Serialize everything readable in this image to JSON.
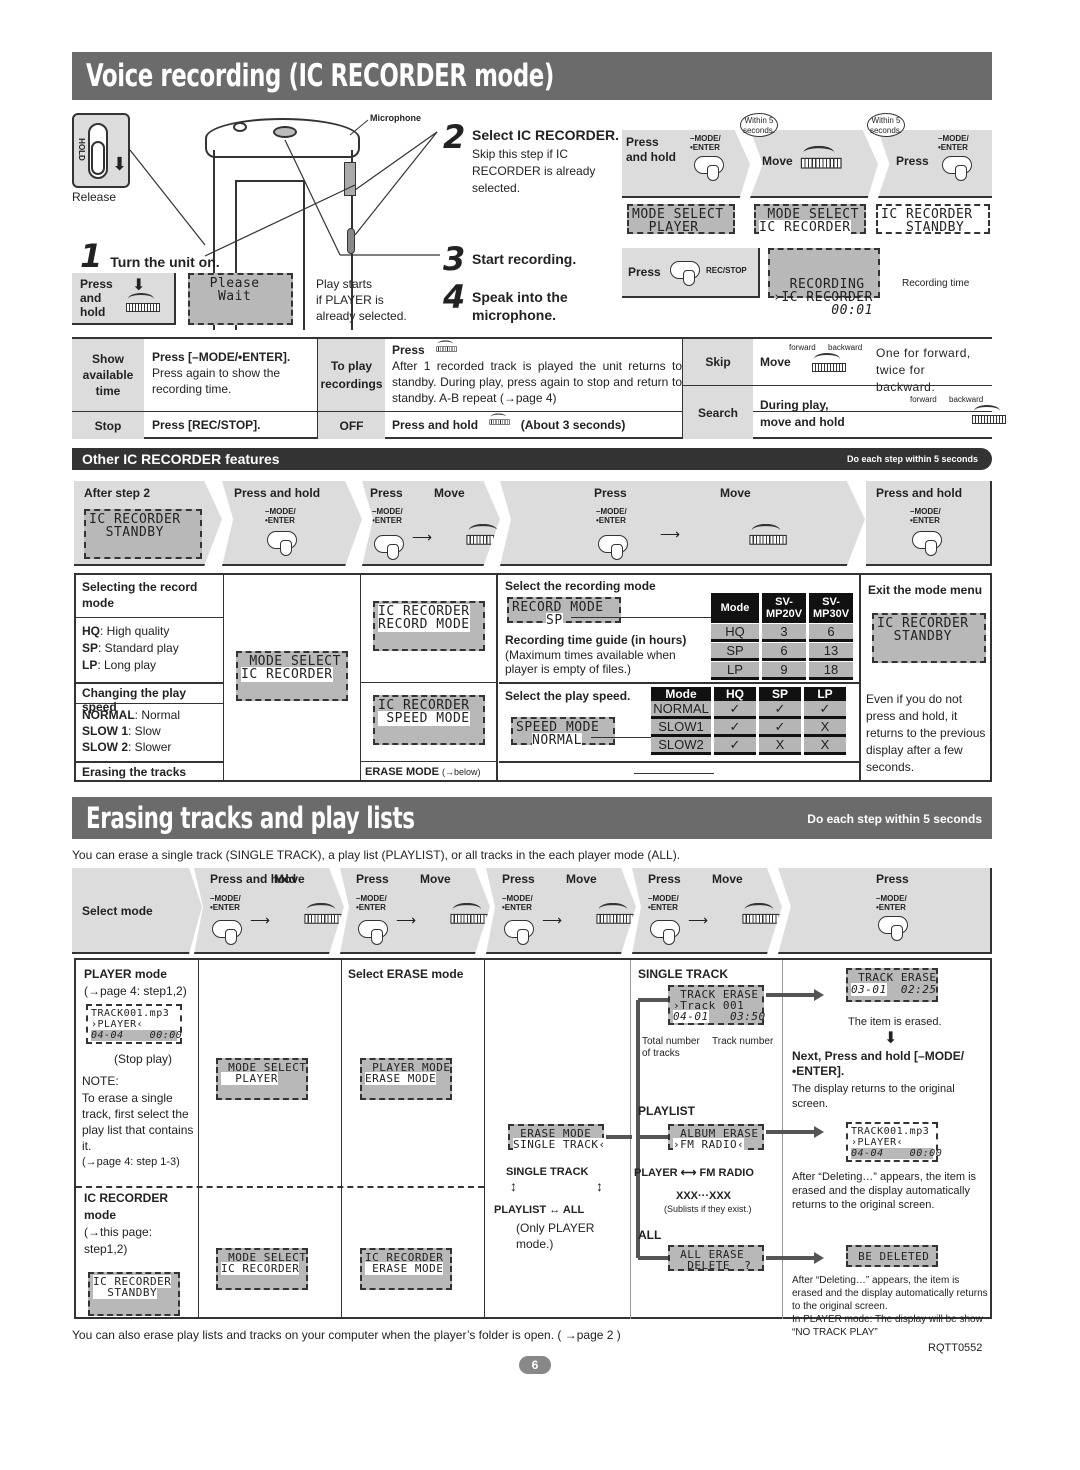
{
  "section1": {
    "title": "Voice recording (IC RECORDER mode)",
    "release_label": "Release",
    "hold_label": "HOLD",
    "microphone_label": "Microphone",
    "step1": {
      "num": "1",
      "title": "Turn the unit on."
    },
    "step1_action": {
      "line1": "Press",
      "line2": "and",
      "line3": "hold"
    },
    "step1_lcd": "  Please\n   Wait",
    "step1_note": [
      "Play starts",
      "if PLAYER is",
      "already selected."
    ],
    "step2": {
      "num": "2",
      "title": "Select IC RECORDER.",
      "desc": [
        "Skip this step if IC",
        "RECORDER is already",
        "selected."
      ]
    },
    "step3": {
      "num": "3",
      "title": "Start recording."
    },
    "step4": {
      "num": "4",
      "title": "Speak into the",
      "title2": "microphone."
    },
    "flow": {
      "press_hold": "Press\nand hold",
      "mode_enter_1": "–MODE/",
      "mode_enter_2": "•ENTER",
      "within1": "Within 5 seconds.",
      "move": "Move",
      "within2": "Within 5 seconds.",
      "press": "Press",
      "lcd1": "MODE SELECT\n  PLAYER",
      "lcd2_l1": " MODE SELECT",
      "lcd2_l2": "IC RECORDER",
      "lcd3_l1": "IC RECORDER",
      "lcd3_l2": "   STANDBY",
      "rec_press": "Press",
      "rec_stop": "REC/STOP",
      "lcd4_l1": "  RECORDING",
      "lcd4_l2": "›IC RECORDER",
      "lcd4_l3": "       00:01",
      "recording_time": "Recording time"
    }
  },
  "ops_table": {
    "rows": [
      {
        "label": "Show available time",
        "bold": "Press [–MODE/•ENTER].",
        "text": "Press again to show the recording time."
      },
      {
        "label": "Stop",
        "bold": "Press [REC/STOP].",
        "text": ""
      }
    ],
    "play": {
      "label": "To play recordings",
      "bold": "Press",
      "text": "After 1 recorded track is played the unit returns to standby. During play, press again to stop and return to standby. A-B repeat (→page 4)"
    },
    "off": {
      "label": "OFF",
      "text": "Press and hold",
      "suffix": "(About 3 seconds)"
    },
    "skip": {
      "label": "Skip",
      "action": "Move",
      "forward": "forward",
      "backward": "backward",
      "text": "One for forward, twice for backward."
    },
    "search": {
      "label": "Search",
      "action": "During play, move and hold",
      "forward": "forward",
      "backward": "backward"
    }
  },
  "features": {
    "title": "Other IC RECORDER features",
    "tip": "Do each step within 5 seconds",
    "flow": {
      "after_step": "After step 2",
      "lcd_standby_l1": "IC RECORDER",
      "lcd_standby_l2": "  STANDBY",
      "press_hold": "Press and hold",
      "press": "Press",
      "move": "Move",
      "press2": "Press",
      "move2": "Move",
      "press_hold2": "Press and hold",
      "mode1": "–MODE/",
      "mode2": "•ENTER"
    },
    "left": {
      "record_title": "Selecting the record mode",
      "record_items": [
        {
          "k": "HQ",
          "v": ": High quality"
        },
        {
          "k": "SP",
          "v": ": Standard play"
        },
        {
          "k": "LP",
          "v": ": Long play"
        }
      ],
      "speed_title": "Changing the play speed",
      "speed_items": [
        {
          "k": "NORMAL",
          "v": ": Normal"
        },
        {
          "k": "SLOW 1",
          "v": ":  Slow"
        },
        {
          "k": "SLOW 2",
          "v": ":  Slower"
        }
      ],
      "erase_title": "Erasing the tracks"
    },
    "lcd_modeselect_l1": " MODE SELECT",
    "lcd_modeselect_l2": "IC RECORDER",
    "lcd_recmode_l1": "IC RECORDER",
    "lcd_recmode_l2": "RECORD MODE",
    "lcd_speedmode_l1": "IC RECORDER",
    "lcd_speedmode_l2": " SPEED MODE",
    "erase_mode": "ERASE MODE",
    "erase_mode_ref": "(→below)",
    "rec_select": {
      "title": "Select the recording mode",
      "lcd_l1": "RECORD MODE",
      "lcd_l2": "SP",
      "guide_title": "Recording time guide (in hours)",
      "guide_text": "(Maximum times available when player is empty of files.)",
      "headers": [
        "Mode",
        "SV-\nMP20V",
        "SV-\nMP30V"
      ],
      "rows": [
        [
          "HQ",
          "3",
          "6"
        ],
        [
          "SP",
          "6",
          "13"
        ],
        [
          "LP",
          "9",
          "18"
        ]
      ]
    },
    "speed_select": {
      "title": "Select the play speed.",
      "lcd_l1": "SPEED MODE",
      "lcd_l2": "NORMAL",
      "headers": [
        "Mode",
        "HQ",
        "SP",
        "LP"
      ],
      "rows": [
        [
          "NORMAL",
          "✓",
          "✓",
          "✓"
        ],
        [
          "SLOW1",
          "✓",
          "✓",
          "X"
        ],
        [
          "SLOW2",
          "✓",
          "X",
          "X"
        ]
      ]
    },
    "exit": {
      "title": "Exit the mode menu",
      "lcd_l1": "IC RECORDER",
      "lcd_l2": "  STANDBY",
      "text": "Even if you do not press and hold, it returns to the previous display after a few seconds."
    }
  },
  "section2": {
    "title": "Erasing tracks and play lists",
    "tip": "Do each step within 5 seconds",
    "intro": "You can erase a single track (SINGLE TRACK), a play list (PLAYLIST), or all tracks in the each player mode (ALL).",
    "flow": {
      "select_mode": "Select mode",
      "steps": [
        {
          "a": "Press and hold",
          "b": "Move"
        },
        {
          "a": "Press",
          "b": "Move"
        },
        {
          "a": "Press",
          "b": "Move"
        },
        {
          "a": "Press",
          "b": "Move"
        },
        {
          "a": "Press",
          "b": ""
        }
      ],
      "mode1": "–MODE/",
      "mode2": "•ENTER"
    },
    "player_mode": {
      "title": "PLAYER mode",
      "ref": "(→page 4: step1,2)",
      "lcd_l1": "TRACK001.mp3",
      "lcd_l2": "›PLAYER‹",
      "lcd_l3": "04-04    00:00",
      "stop_play": "(Stop play)",
      "note_title": "NOTE:",
      "note": "To erase a single track, first select the play list that contains it.",
      "note_ref": "(→page 4: step 1-3)"
    },
    "ic_mode": {
      "title": "IC RECORDER mode",
      "ref": "(→this page: step1,2)",
      "lcd_l1": "IC RECORDER",
      "lcd_l2": "  STANDBY"
    },
    "col2": {
      "lcd_p_l1": " MODE SELECT",
      "lcd_p_l2": "  PLAYER",
      "lcd_i_l1": " MODE SELECT",
      "lcd_i_l2": "IC RECORDER"
    },
    "col3": {
      "title": "Select ERASE mode",
      "lcd_p_l1": " PLAYER MODE",
      "lcd_p_l2": "ERASE MODE",
      "lcd_i_l1": "IC RECORDER",
      "lcd_i_l2": " ERASE MODE"
    },
    "col4": {
      "lcd_l1": " ERASE MODE",
      "lcd_l2": "SINGLE TRACK‹",
      "single": "SINGLE TRACK",
      "playlist": "PLAYLIST",
      "all": "ALL",
      "only": "(Only PLAYER mode.)"
    },
    "col5": {
      "single_title": "SINGLE TRACK",
      "single_lcd_l1": " TRACK ERASE",
      "single_lcd_l2": "›Track 001",
      "single_lcd_l3a": "04-01",
      "single_lcd_l3b": "03:50",
      "total_label": "Total number of tracks",
      "track_label": "Track number",
      "playlist_title": "PLAYLIST",
      "playlist_lcd_l1": " ALBUM ERASE",
      "playlist_lcd_l2": "›FM RADIO‹",
      "player": "PLAYER",
      "fm_radio": "FM RADIO",
      "xxx": "XXX···XXX",
      "sublists": "(Sublists if they exist.)",
      "all_title": "ALL",
      "all_lcd_l1": " ALL ERASE",
      "all_lcd_l2": "  DELETE  ?"
    },
    "col6": {
      "press": "Press",
      "erased_lcd_l1": " TRACK ERASE",
      "erased_lcd_l2a": "03-01",
      "erased_lcd_l2b": "02:25",
      "erased": "The item is erased.",
      "next": "Next, Press and hold [–MODE/•ENTER].",
      "next_desc": "The display returns to the original screen.",
      "pl_lcd_l1": "TRACK001.mp3",
      "pl_lcd_l2": "›PLAYER‹",
      "pl_lcd_l3": "04-04    00:00",
      "pl_desc": "After “Deleting…” appears, the item is erased and the display automatically returns to the original screen.",
      "all_lcd": " BE DELETED",
      "all_desc": "After “Deleting…” appears, the item is erased and the display automatically returns to the original screen.",
      "all_note": "In PLAYER mode: The display will be show “NO TRACK PLAY”"
    },
    "footer": "You can also erase play lists and tracks on your computer when the player’s folder is open. ( →page 2 )"
  },
  "doc_code": "RQTT0552",
  "page_number": "6"
}
